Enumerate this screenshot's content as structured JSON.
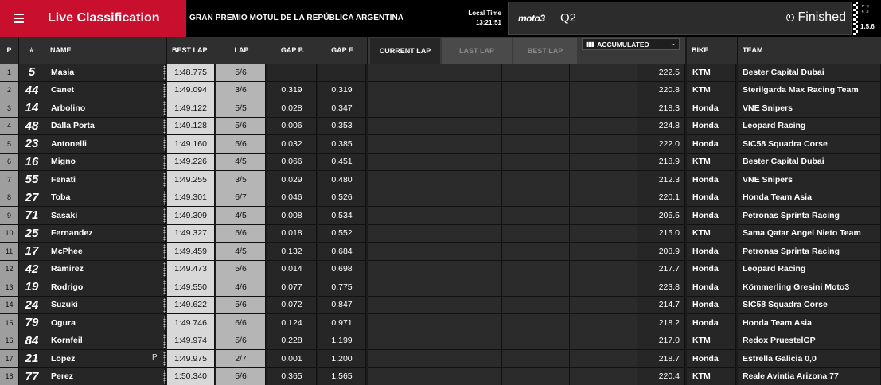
{
  "app": {
    "title": "Live Classification",
    "event": "GRAN PREMIO MOTUL DE LA REPÚBLICA ARGENTINA",
    "local_time_label": "Local Time",
    "local_time": "13:21:51",
    "class_logo": "moto3",
    "session": "Q2",
    "status": "Finished",
    "version": "1.5.6"
  },
  "header": {
    "p": "P",
    "num": "#",
    "name": "NAME",
    "best_lap": "BEST LAP",
    "lap": "LAP",
    "gap_p": "GAP P.",
    "gap_f": "GAP F.",
    "bike": "BIKE",
    "team": "TEAM"
  },
  "tabs": {
    "current": "CURRENT LAP",
    "last": "LAST LAP",
    "best": "BEST LAP"
  },
  "accumulated": "ACCUMULATED",
  "rows": [
    {
      "p": "1",
      "num": "5",
      "name": "Masia",
      "best": "1:48.775",
      "lap": "5/6",
      "gapp": "",
      "gapf": "",
      "speed": "222.5",
      "bike": "KTM",
      "team": "Bester Capital Dubai",
      "flag": ""
    },
    {
      "p": "2",
      "num": "44",
      "name": "Canet",
      "best": "1:49.094",
      "lap": "3/6",
      "gapp": "0.319",
      "gapf": "0.319",
      "speed": "220.8",
      "bike": "KTM",
      "team": "Sterilgarda Max Racing Team",
      "flag": ""
    },
    {
      "p": "3",
      "num": "14",
      "name": "Arbolino",
      "best": "1:49.122",
      "lap": "5/5",
      "gapp": "0.028",
      "gapf": "0.347",
      "speed": "218.3",
      "bike": "Honda",
      "team": "VNE Snipers",
      "flag": ""
    },
    {
      "p": "4",
      "num": "48",
      "name": "Dalla Porta",
      "best": "1:49.128",
      "lap": "5/6",
      "gapp": "0.006",
      "gapf": "0.353",
      "speed": "224.8",
      "bike": "Honda",
      "team": "Leopard Racing",
      "flag": ""
    },
    {
      "p": "5",
      "num": "23",
      "name": "Antonelli",
      "best": "1:49.160",
      "lap": "5/6",
      "gapp": "0.032",
      "gapf": "0.385",
      "speed": "222.0",
      "bike": "Honda",
      "team": "SIC58 Squadra Corse",
      "flag": ""
    },
    {
      "p": "6",
      "num": "16",
      "name": "Migno",
      "best": "1:49.226",
      "lap": "4/5",
      "gapp": "0.066",
      "gapf": "0.451",
      "speed": "218.9",
      "bike": "KTM",
      "team": "Bester Capital Dubai",
      "flag": ""
    },
    {
      "p": "7",
      "num": "55",
      "name": "Fenati",
      "best": "1:49.255",
      "lap": "3/5",
      "gapp": "0.029",
      "gapf": "0.480",
      "speed": "212.3",
      "bike": "Honda",
      "team": "VNE Snipers",
      "flag": ""
    },
    {
      "p": "8",
      "num": "27",
      "name": "Toba",
      "best": "1:49.301",
      "lap": "6/7",
      "gapp": "0.046",
      "gapf": "0.526",
      "speed": "220.1",
      "bike": "Honda",
      "team": "Honda Team Asia",
      "flag": ""
    },
    {
      "p": "9",
      "num": "71",
      "name": "Sasaki",
      "best": "1:49.309",
      "lap": "4/5",
      "gapp": "0.008",
      "gapf": "0.534",
      "speed": "205.5",
      "bike": "Honda",
      "team": "Petronas Sprinta Racing",
      "flag": ""
    },
    {
      "p": "10",
      "num": "25",
      "name": "Fernandez",
      "best": "1:49.327",
      "lap": "5/6",
      "gapp": "0.018",
      "gapf": "0.552",
      "speed": "215.0",
      "bike": "KTM",
      "team": "Sama Qatar Angel Nieto Team",
      "flag": ""
    },
    {
      "p": "11",
      "num": "17",
      "name": "McPhee",
      "best": "1:49.459",
      "lap": "4/5",
      "gapp": "0.132",
      "gapf": "0.684",
      "speed": "208.9",
      "bike": "Honda",
      "team": "Petronas Sprinta Racing",
      "flag": ""
    },
    {
      "p": "12",
      "num": "42",
      "name": "Ramirez",
      "best": "1:49.473",
      "lap": "5/6",
      "gapp": "0.014",
      "gapf": "0.698",
      "speed": "217.7",
      "bike": "Honda",
      "team": "Leopard Racing",
      "flag": ""
    },
    {
      "p": "13",
      "num": "19",
      "name": "Rodrigo",
      "best": "1:49.550",
      "lap": "4/6",
      "gapp": "0.077",
      "gapf": "0.775",
      "speed": "223.8",
      "bike": "Honda",
      "team": "Kömmerling Gresini Moto3",
      "flag": ""
    },
    {
      "p": "14",
      "num": "24",
      "name": "Suzuki",
      "best": "1:49.622",
      "lap": "5/6",
      "gapp": "0.072",
      "gapf": "0.847",
      "speed": "214.7",
      "bike": "Honda",
      "team": "SIC58 Squadra Corse",
      "flag": ""
    },
    {
      "p": "15",
      "num": "79",
      "name": "Ogura",
      "best": "1:49.746",
      "lap": "6/6",
      "gapp": "0.124",
      "gapf": "0.971",
      "speed": "218.2",
      "bike": "Honda",
      "team": "Honda Team Asia",
      "flag": ""
    },
    {
      "p": "16",
      "num": "84",
      "name": "Kornfeil",
      "best": "1:49.974",
      "lap": "5/6",
      "gapp": "0.228",
      "gapf": "1.199",
      "speed": "217.0",
      "bike": "KTM",
      "team": "Redox PruestelGP",
      "flag": ""
    },
    {
      "p": "17",
      "num": "21",
      "name": "Lopez",
      "best": "1:49.975",
      "lap": "2/7",
      "gapp": "0.001",
      "gapf": "1.200",
      "speed": "218.7",
      "bike": "Honda",
      "team": "Estrella Galicia 0,0",
      "flag": "P"
    },
    {
      "p": "18",
      "num": "77",
      "name": "Perez",
      "best": "1:50.340",
      "lap": "5/6",
      "gapp": "0.365",
      "gapf": "1.565",
      "speed": "220.4",
      "bike": "KTM",
      "team": "Reale Avintia Arizona 77",
      "flag": ""
    }
  ]
}
